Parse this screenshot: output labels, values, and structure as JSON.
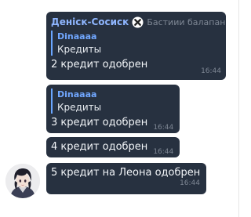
{
  "messages": [
    {
      "sender": "Деніск-Сосиск",
      "sender_tag": "Бастиии балапан",
      "reply_to": {
        "name": "Dinaaaa",
        "text": "Кредиты"
      },
      "text": "2 кредит одобрен",
      "time": "16:44"
    },
    {
      "reply_to": {
        "name": "Dinaaaa",
        "text": "Кредиты"
      },
      "text": "3 кредит одобрен",
      "time": "16:44"
    },
    {
      "text": "4 кредит одобрен",
      "time": "16:44"
    },
    {
      "text": "5 кредит на Леона одобрен",
      "time": "16:44"
    }
  ],
  "icons": {
    "sender_badge": "x-badge-icon",
    "avatar": "user-avatar"
  },
  "colors": {
    "bubble": "#273140",
    "sender_name": "#8fb6ff",
    "quote_bar": "#6aa6ff",
    "timestamp": "#7e8794"
  }
}
